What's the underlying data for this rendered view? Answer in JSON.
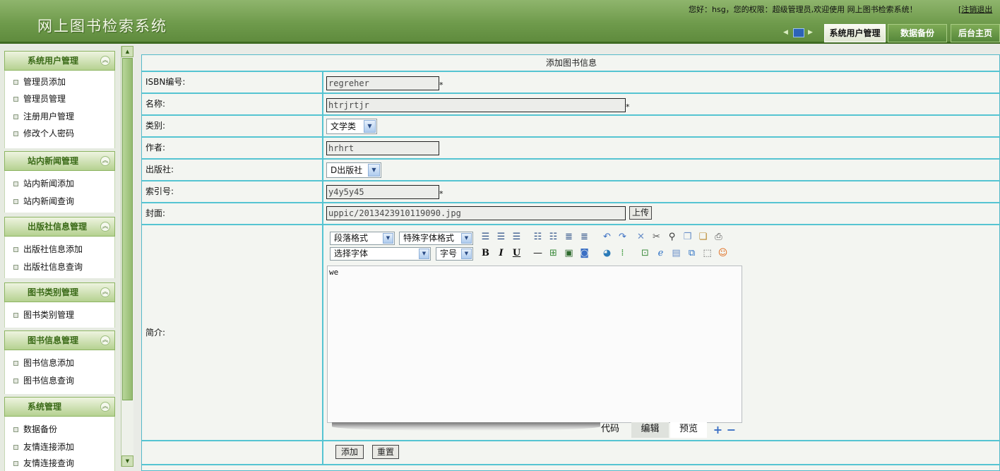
{
  "header": {
    "app_title": "网上图书检索系统",
    "welcome": "您好：hsg，您的权限：超级管理员,欢迎使用 网上图书检索系统！",
    "logout_bracket": "[",
    "logout_label": "注销退出",
    "nav_tabs": [
      {
        "label": "系统用户管理"
      },
      {
        "label": "数据备份"
      },
      {
        "label": "后台主页"
      }
    ]
  },
  "sidebar": {
    "groups": [
      {
        "title": "系统用户管理",
        "items": [
          "管理员添加",
          "管理员管理",
          "注册用户管理",
          "修改个人密码"
        ]
      },
      {
        "title": "站内新闻管理",
        "items": [
          "站内新闻添加",
          "站内新闻查询"
        ]
      },
      {
        "title": "出版社信息管理",
        "items": [
          "出版社信息添加",
          "出版社信息查询"
        ]
      },
      {
        "title": "图书类别管理",
        "items": [
          "图书类别管理"
        ]
      },
      {
        "title": "图书信息管理",
        "items": [
          "图书信息添加",
          "图书信息查询"
        ]
      },
      {
        "title": "系统管理",
        "items": [
          "数据备份",
          "友情连接添加",
          "友情连接查询"
        ]
      }
    ]
  },
  "form": {
    "title": "添加图书信息",
    "required_mark": "*",
    "isbn": {
      "label": "ISBN编号:",
      "value": "regreher"
    },
    "name": {
      "label": "名称:",
      "value": "htrjrtjr"
    },
    "category": {
      "label": "类别:",
      "value": "文学类"
    },
    "author": {
      "label": "作者:",
      "value": "hrhrt"
    },
    "publisher": {
      "label": "出版社:",
      "value": "D出版社"
    },
    "index_no": {
      "label": "索引号:",
      "value": "y4y5y45"
    },
    "cover": {
      "label": "封面:",
      "value": "uppic/2013423910119090.jpg",
      "upload_label": "上传"
    },
    "intro": {
      "label": "简介:"
    },
    "submit_label": "添加",
    "reset_label": "重置"
  },
  "editor": {
    "paragraph_format": "段落格式",
    "special_format": "特殊字体格式",
    "font_select": "选择字体",
    "font_size": "字号",
    "bold": "B",
    "italic": "I",
    "underline": "U",
    "content": "we",
    "tabs": {
      "code": "代码",
      "edit": "编辑",
      "preview": "预览"
    }
  },
  "colors": {
    "header_green": "#6f9b4c",
    "grid_cyan": "#55c4d2",
    "panel_bg": "#f3f5f1"
  }
}
